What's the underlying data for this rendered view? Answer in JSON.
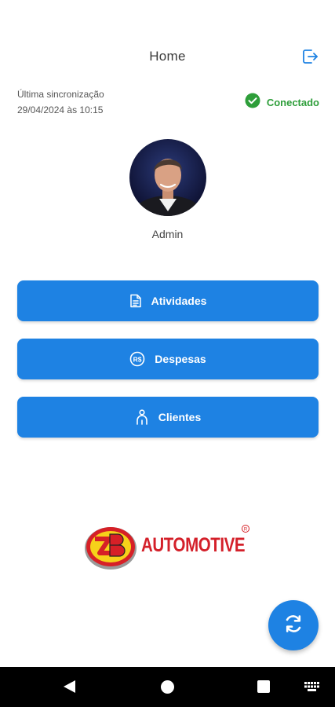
{
  "header": {
    "title": "Home"
  },
  "sync": {
    "label": "Última sincronização",
    "timestamp": "29/04/2024 às 10:15"
  },
  "status": {
    "label": "Conectado",
    "color": "#2e9e3a"
  },
  "user": {
    "name": "Admin"
  },
  "menu": {
    "items": [
      {
        "label": "Atividades",
        "icon": "document-icon"
      },
      {
        "label": "Despesas",
        "icon": "currency-icon"
      },
      {
        "label": "Clientes",
        "icon": "person-icon"
      }
    ]
  },
  "brand": {
    "name": "AUTOMOTIVE",
    "mark": "EZB"
  },
  "colors": {
    "primary": "#1e82e3",
    "success": "#2e9e3a"
  }
}
